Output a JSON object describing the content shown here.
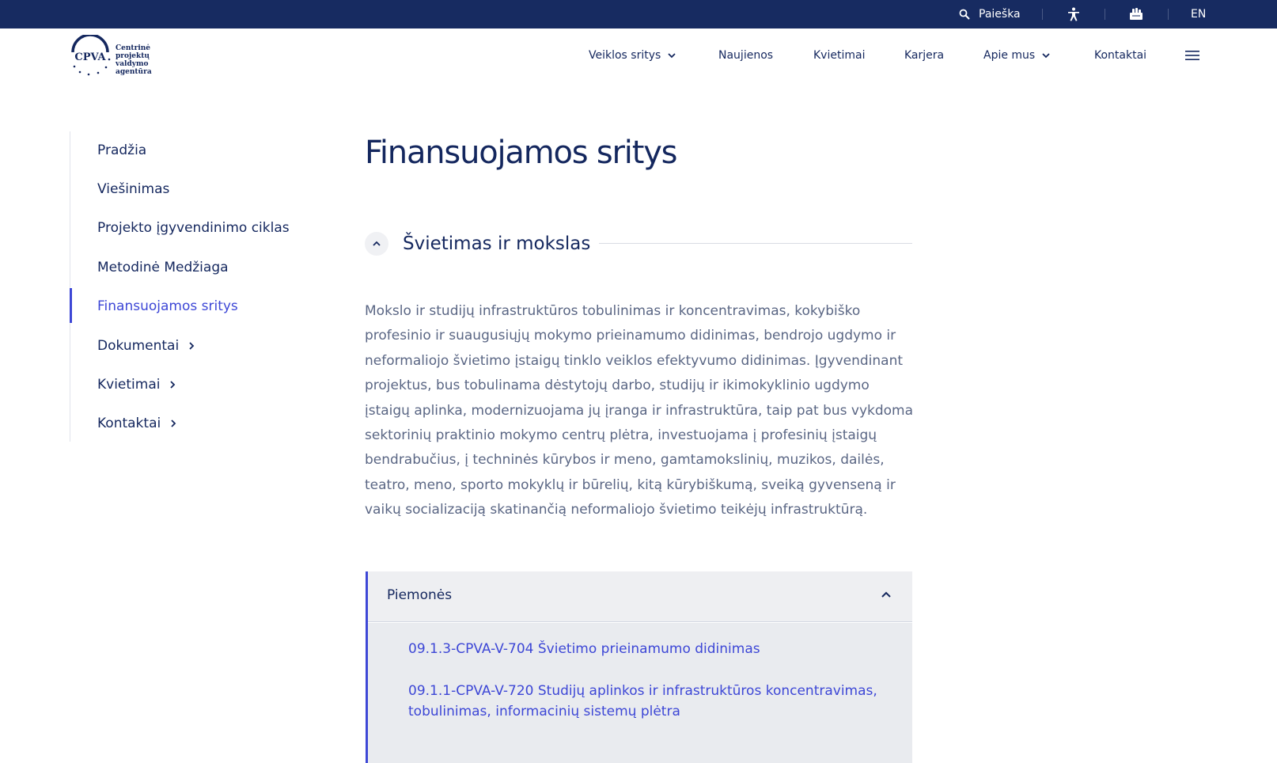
{
  "topbar": {
    "search_label": "Paieška",
    "search_icon": "search-icon",
    "accessibility_icon": "accessibility-icon",
    "sign_language_icon": "sign-language-icon",
    "language": "EN"
  },
  "header": {
    "logo_abbr": "CPVA",
    "logo_line1": "Centrinė",
    "logo_line2": "projektų valdymo",
    "logo_line3": "agentūra",
    "nav": [
      {
        "label": "Veiklos sritys",
        "has_dropdown": true
      },
      {
        "label": "Naujienos",
        "has_dropdown": false
      },
      {
        "label": "Kvietimai",
        "has_dropdown": false
      },
      {
        "label": "Karjera",
        "has_dropdown": false
      },
      {
        "label": "Apie mus",
        "has_dropdown": true
      },
      {
        "label": "Kontaktai",
        "has_dropdown": false
      }
    ],
    "menu_icon": "hamburger-menu-icon"
  },
  "sidebar": {
    "items": [
      {
        "label": "Pradžia"
      },
      {
        "label": "Viešinimas"
      },
      {
        "label": "Projekto įgyvendinimo ciklas"
      },
      {
        "label": "Metodinė Medžiaga"
      },
      {
        "label": "Finansuojamos sritys",
        "active": true
      },
      {
        "label": "Dokumentai",
        "has_children": true
      },
      {
        "label": "Kvietimai",
        "has_children": true
      },
      {
        "label": "Kontaktai",
        "has_children": true
      }
    ]
  },
  "main": {
    "title": "Finansuojamos sritys",
    "section": {
      "title": "Švietimas ir mokslas",
      "body": "Mokslo ir studijų infrastruktūros tobulinimas ir koncentravimas, kokybiško profesinio ir suaugusiųjų mokymo prieinamumo didinimas, bendrojo ugdymo ir neformaliojo švietimo įstaigų tinklo veiklos efektyvumo didinimas. Įgyvendinant projektus, bus tobulinama dėstytojų darbo, studijų ir ikimokyklinio ugdymo įstaigų aplinka, modernizuojama jų įranga ir infrastruktūra, taip pat bus vykdoma sektorinių praktinio mokymo centrų plėtra, investuojama į profesinių įstaigų bendrabučius, į techninės kūrybos ir meno, gamtamokslinių, muzikos, dailės, teatro, meno, sporto mokyklų ir būrelių, kitą kūrybiškumą, sveiką gyvenseną ir vaikų socializaciją skatinančią neformaliojo švietimo teikėjų infrastruktūrą."
    },
    "accordion": {
      "title": "Piemonės",
      "links": [
        {
          "label": "09.1.3-CPVA-V-704 Švietimo prieinamumo didinimas"
        },
        {
          "label": "09.1.1-CPVA-V-720 Studijų aplinkos ir infrastruktūros koncentravimas, tobulinimas, informacinių sistemų plėtra"
        }
      ]
    }
  },
  "colors": {
    "topbar_bg": "#172b61",
    "primary_text": "#14275e",
    "accent": "#3d47d6",
    "body_text": "#5a6684",
    "accordion_bg": "#eeeff2"
  }
}
